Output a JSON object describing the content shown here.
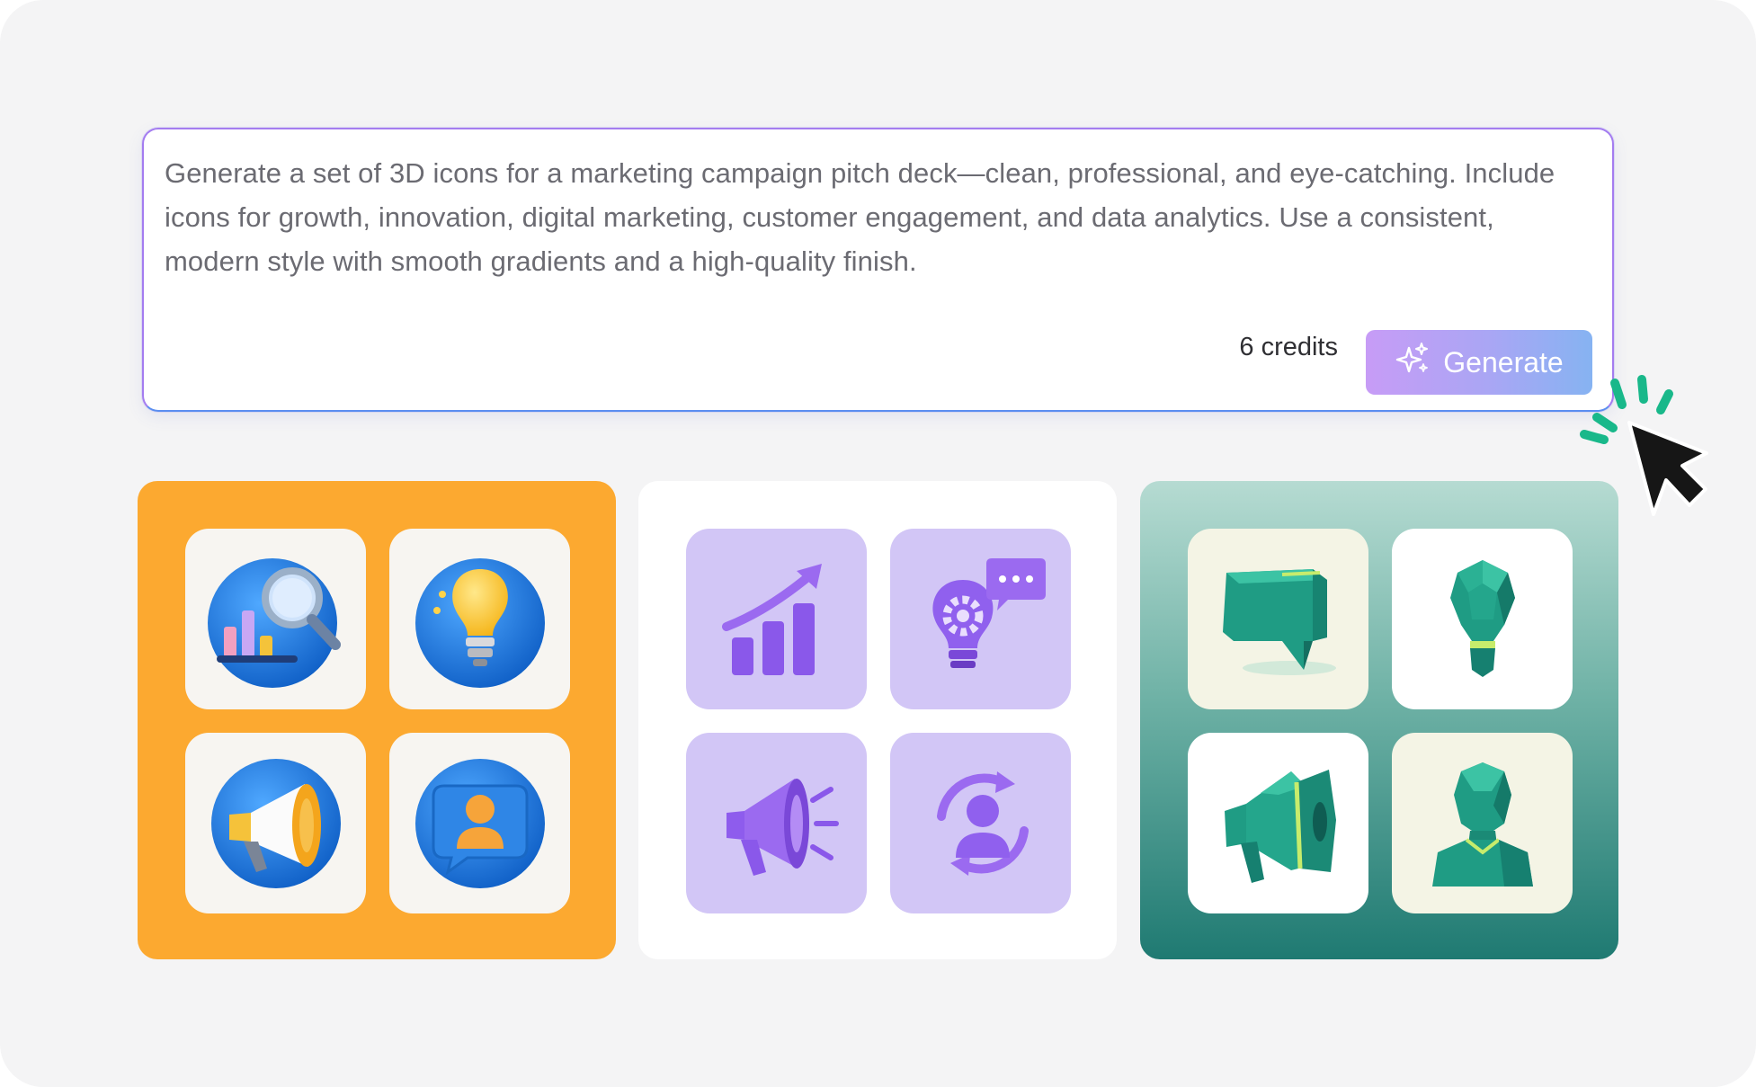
{
  "prompt": {
    "text": "Generate a set of 3D icons for a marketing campaign pitch deck—clean, professional, and eye-catching. Include icons for growth, innovation, digital marketing, customer engagement, and data analytics. Use a consistent, modern style with smooth gradients and a high-quality finish.",
    "credits_label": "6 credits",
    "generate_label": "Generate",
    "generate_icon": "sparkle-icon"
  },
  "colors": {
    "accent_border": "#a47cf0",
    "generate_gradient": [
      "#c79cf6",
      "#86b3f2"
    ],
    "orange_set_bg": "#fca930",
    "teal_set_bg": [
      "#b6dbd2",
      "#1f7a72"
    ],
    "click_burst": "#19b88a"
  },
  "icon_sets": [
    {
      "style": "blue-3d",
      "icons": [
        "data-analytics-icon",
        "lightbulb-icon",
        "megaphone-icon",
        "customer-profile-icon"
      ]
    },
    {
      "style": "purple-3d",
      "icons": [
        "growth-chart-icon",
        "innovation-lightbulb-icon",
        "megaphone-icon",
        "customer-engagement-icon"
      ]
    },
    {
      "style": "teal-lowpoly",
      "icons": [
        "speech-bubble-icon",
        "lightbulb-icon",
        "megaphone-icon",
        "person-bust-icon"
      ]
    }
  ]
}
